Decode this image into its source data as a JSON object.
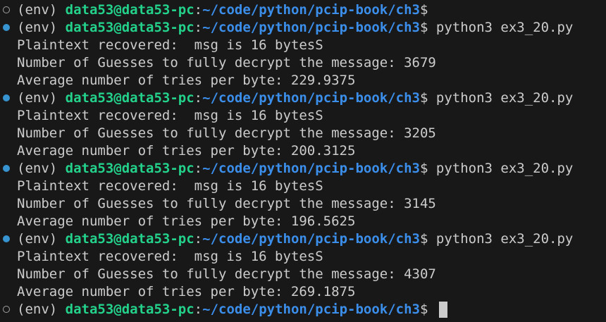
{
  "terminal": {
    "lines": [
      {
        "kind": "prompt",
        "marker": "open",
        "env": "(env) ",
        "user": "data53@data53-pc",
        "sep": ":",
        "path": "~/code/python/pcip-book/ch3",
        "dollar": "$ ",
        "command": ""
      },
      {
        "kind": "prompt",
        "marker": "filled",
        "env": "(env) ",
        "user": "data53@data53-pc",
        "sep": ":",
        "path": "~/code/python/pcip-book/ch3",
        "dollar": "$ ",
        "command": "python3 ex3_20.py"
      },
      {
        "kind": "output",
        "text": "Plaintext recovered:  msg is 16 bytesS"
      },
      {
        "kind": "output",
        "text": "Number of Guesses to fully decrypt the message: 3679"
      },
      {
        "kind": "output",
        "text": "Average number of tries per byte: 229.9375"
      },
      {
        "kind": "prompt",
        "marker": "filled",
        "env": "(env) ",
        "user": "data53@data53-pc",
        "sep": ":",
        "path": "~/code/python/pcip-book/ch3",
        "dollar": "$ ",
        "command": "python3 ex3_20.py"
      },
      {
        "kind": "output",
        "text": "Plaintext recovered:  msg is 16 bytesS"
      },
      {
        "kind": "output",
        "text": "Number of Guesses to fully decrypt the message: 3205"
      },
      {
        "kind": "output",
        "text": "Average number of tries per byte: 200.3125"
      },
      {
        "kind": "prompt",
        "marker": "filled",
        "env": "(env) ",
        "user": "data53@data53-pc",
        "sep": ":",
        "path": "~/code/python/pcip-book/ch3",
        "dollar": "$ ",
        "command": "python3 ex3_20.py"
      },
      {
        "kind": "output",
        "text": "Plaintext recovered:  msg is 16 bytesS"
      },
      {
        "kind": "output",
        "text": "Number of Guesses to fully decrypt the message: 3145"
      },
      {
        "kind": "output",
        "text": "Average number of tries per byte: 196.5625"
      },
      {
        "kind": "prompt",
        "marker": "filled",
        "env": "(env) ",
        "user": "data53@data53-pc",
        "sep": ":",
        "path": "~/code/python/pcip-book/ch3",
        "dollar": "$ ",
        "command": "python3 ex3_20.py"
      },
      {
        "kind": "output",
        "text": "Plaintext recovered:  msg is 16 bytesS"
      },
      {
        "kind": "output",
        "text": "Number of Guesses to fully decrypt the message: 4307"
      },
      {
        "kind": "output",
        "text": "Average number of tries per byte: 269.1875"
      },
      {
        "kind": "prompt",
        "marker": "open",
        "env": "(env) ",
        "user": "data53@data53-pc",
        "sep": ":",
        "path": "~/code/python/pcip-book/ch3",
        "dollar": "$ ",
        "command": "",
        "cursor": true
      }
    ]
  },
  "colors": {
    "background": "#181818",
    "text": "#cccccc",
    "user": "#23d18b",
    "path": "#3b8eea",
    "marker_filled": "#3794d0",
    "marker_open": "#a0a0a0"
  }
}
